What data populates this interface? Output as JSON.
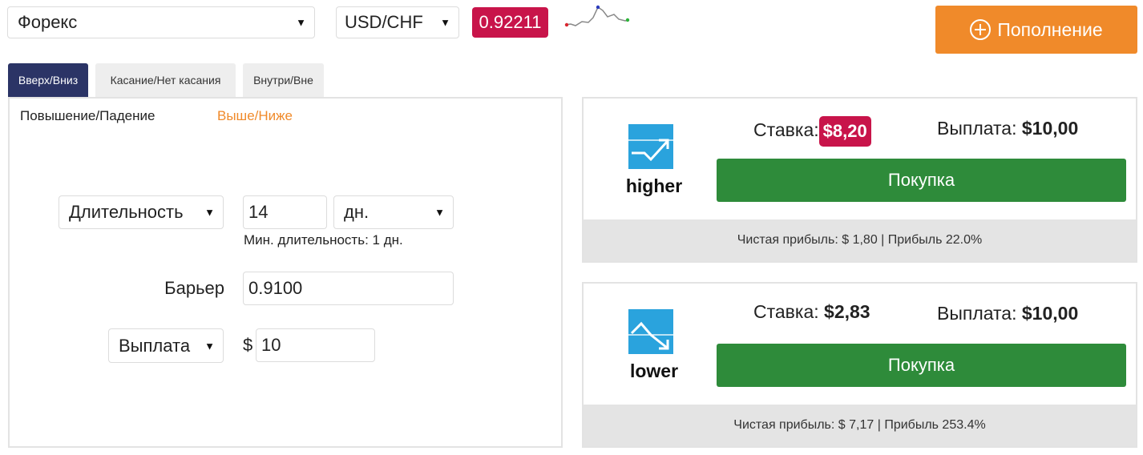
{
  "market_select": {
    "value": "Форекс"
  },
  "symbol_select": {
    "value": "USD/CHF"
  },
  "current_price": "0.92211",
  "deposit_button": {
    "label": "Пополнение"
  },
  "trade_tabs": [
    {
      "label": "Вверх/Вниз",
      "active": true
    },
    {
      "label": "Касание/Нет касания",
      "active": false
    },
    {
      "label": "Внутри/Вне",
      "active": false
    }
  ],
  "sub_tabs": [
    {
      "label": "Повышение/Падение",
      "active": false
    },
    {
      "label": "Выше/Ниже",
      "active": true
    }
  ],
  "form": {
    "duration_type": "Длительность",
    "duration_value": "14",
    "duration_unit": "дн.",
    "min_duration_note": "Мин. длительность: 1 дн.",
    "barrier_label": "Барьер",
    "barrier_value": "0.9100",
    "amount_type": "Выплата",
    "currency_symbol": "$",
    "amount_value": "10"
  },
  "contracts": [
    {
      "direction": "higher",
      "stake_label": "Ставка:",
      "stake_value": "$8,20",
      "payout_label": "Выплата:",
      "payout_value": "$10,00",
      "buy_label": "Покупка",
      "profit_text": "Чистая прибыль: $ 1,80 | Прибыль 22.0%"
    },
    {
      "direction": "lower",
      "stake_label": "Ставка:",
      "stake_value": "$2,83",
      "payout_label": "Выплата:",
      "payout_value": "$10,00",
      "buy_label": "Покупка",
      "profit_text": "Чистая прибыль: $ 7,17 | Прибыль 253.4%"
    }
  ],
  "colors": {
    "accent_orange": "#f08a2a",
    "price_red": "#c8144a",
    "buy_green": "#2e8b3a",
    "tab_active": "#2b3466",
    "icon_blue": "#2aa3dd"
  }
}
